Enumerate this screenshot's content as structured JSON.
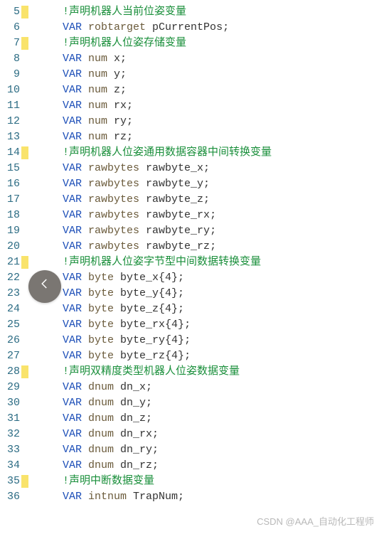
{
  "watermark": "CSDN @AAA_自动化工程师",
  "back_button_icon": "chevron-left",
  "lines": [
    {
      "n": 5,
      "m": true,
      "tokens": [
        {
          "c": "cmt",
          "t": "!声明机器人当前位姿变量"
        }
      ]
    },
    {
      "n": 6,
      "m": false,
      "tokens": [
        {
          "c": "kw",
          "t": "VAR"
        },
        {
          "c": "id",
          "t": " "
        },
        {
          "c": "ty",
          "t": "robtarget"
        },
        {
          "c": "id",
          "t": " pCurrentPos;"
        }
      ]
    },
    {
      "n": 7,
      "m": true,
      "tokens": [
        {
          "c": "cmt",
          "t": "!声明机器人位姿存储变量"
        }
      ]
    },
    {
      "n": 8,
      "m": false,
      "tokens": [
        {
          "c": "kw",
          "t": "VAR"
        },
        {
          "c": "id",
          "t": " "
        },
        {
          "c": "ty",
          "t": "num"
        },
        {
          "c": "id",
          "t": " x;"
        }
      ]
    },
    {
      "n": 9,
      "m": false,
      "tokens": [
        {
          "c": "kw",
          "t": "VAR"
        },
        {
          "c": "id",
          "t": " "
        },
        {
          "c": "ty",
          "t": "num"
        },
        {
          "c": "id",
          "t": " y;"
        }
      ]
    },
    {
      "n": 10,
      "m": false,
      "tokens": [
        {
          "c": "kw",
          "t": "VAR"
        },
        {
          "c": "id",
          "t": " "
        },
        {
          "c": "ty",
          "t": "num"
        },
        {
          "c": "id",
          "t": " z;"
        }
      ]
    },
    {
      "n": 11,
      "m": false,
      "tokens": [
        {
          "c": "kw",
          "t": "VAR"
        },
        {
          "c": "id",
          "t": " "
        },
        {
          "c": "ty",
          "t": "num"
        },
        {
          "c": "id",
          "t": " rx;"
        }
      ]
    },
    {
      "n": 12,
      "m": false,
      "tokens": [
        {
          "c": "kw",
          "t": "VAR"
        },
        {
          "c": "id",
          "t": " "
        },
        {
          "c": "ty",
          "t": "num"
        },
        {
          "c": "id",
          "t": " ry;"
        }
      ]
    },
    {
      "n": 13,
      "m": false,
      "tokens": [
        {
          "c": "kw",
          "t": "VAR"
        },
        {
          "c": "id",
          "t": " "
        },
        {
          "c": "ty",
          "t": "num"
        },
        {
          "c": "id",
          "t": " rz;"
        }
      ]
    },
    {
      "n": 14,
      "m": true,
      "tokens": [
        {
          "c": "cmt",
          "t": "!声明机器人位姿通用数据容器中间转换变量"
        }
      ]
    },
    {
      "n": 15,
      "m": false,
      "tokens": [
        {
          "c": "kw",
          "t": "VAR"
        },
        {
          "c": "id",
          "t": " "
        },
        {
          "c": "ty",
          "t": "rawbytes"
        },
        {
          "c": "id",
          "t": " rawbyte_x;"
        }
      ]
    },
    {
      "n": 16,
      "m": false,
      "tokens": [
        {
          "c": "kw",
          "t": "VAR"
        },
        {
          "c": "id",
          "t": " "
        },
        {
          "c": "ty",
          "t": "rawbytes"
        },
        {
          "c": "id",
          "t": " rawbyte_y;"
        }
      ]
    },
    {
      "n": 17,
      "m": false,
      "tokens": [
        {
          "c": "kw",
          "t": "VAR"
        },
        {
          "c": "id",
          "t": " "
        },
        {
          "c": "ty",
          "t": "rawbytes"
        },
        {
          "c": "id",
          "t": " rawbyte_z;"
        }
      ]
    },
    {
      "n": 18,
      "m": false,
      "tokens": [
        {
          "c": "kw",
          "t": "VAR"
        },
        {
          "c": "id",
          "t": " "
        },
        {
          "c": "ty",
          "t": "rawbytes"
        },
        {
          "c": "id",
          "t": " rawbyte_rx;"
        }
      ]
    },
    {
      "n": 19,
      "m": false,
      "tokens": [
        {
          "c": "kw",
          "t": "VAR"
        },
        {
          "c": "id",
          "t": " "
        },
        {
          "c": "ty",
          "t": "rawbytes"
        },
        {
          "c": "id",
          "t": " rawbyte_ry;"
        }
      ]
    },
    {
      "n": 20,
      "m": false,
      "tokens": [
        {
          "c": "kw",
          "t": "VAR"
        },
        {
          "c": "id",
          "t": " "
        },
        {
          "c": "ty",
          "t": "rawbytes"
        },
        {
          "c": "id",
          "t": " rawbyte_rz;"
        }
      ]
    },
    {
      "n": 21,
      "m": true,
      "tokens": [
        {
          "c": "cmt",
          "t": "!声明机器人位姿字节型中间数据转换变量"
        }
      ]
    },
    {
      "n": 22,
      "m": false,
      "tokens": [
        {
          "c": "kw",
          "t": "VAR"
        },
        {
          "c": "id",
          "t": " "
        },
        {
          "c": "ty",
          "t": "byte"
        },
        {
          "c": "id",
          "t": " byte_x{4};"
        }
      ]
    },
    {
      "n": 23,
      "m": false,
      "tokens": [
        {
          "c": "kw",
          "t": "VAR"
        },
        {
          "c": "id",
          "t": " "
        },
        {
          "c": "ty",
          "t": "byte"
        },
        {
          "c": "id",
          "t": " byte_y{4};"
        }
      ]
    },
    {
      "n": 24,
      "m": false,
      "tokens": [
        {
          "c": "kw",
          "t": "VAR"
        },
        {
          "c": "id",
          "t": " "
        },
        {
          "c": "ty",
          "t": "byte"
        },
        {
          "c": "id",
          "t": " byte_z{4};"
        }
      ]
    },
    {
      "n": 25,
      "m": false,
      "tokens": [
        {
          "c": "kw",
          "t": "VAR"
        },
        {
          "c": "id",
          "t": " "
        },
        {
          "c": "ty",
          "t": "byte"
        },
        {
          "c": "id",
          "t": " byte_rx{4};"
        }
      ]
    },
    {
      "n": 26,
      "m": false,
      "tokens": [
        {
          "c": "kw",
          "t": "VAR"
        },
        {
          "c": "id",
          "t": " "
        },
        {
          "c": "ty",
          "t": "byte"
        },
        {
          "c": "id",
          "t": " byte_ry{4};"
        }
      ]
    },
    {
      "n": 27,
      "m": false,
      "tokens": [
        {
          "c": "kw",
          "t": "VAR"
        },
        {
          "c": "id",
          "t": " "
        },
        {
          "c": "ty",
          "t": "byte"
        },
        {
          "c": "id",
          "t": " byte_rz{4};"
        }
      ]
    },
    {
      "n": 28,
      "m": true,
      "tokens": [
        {
          "c": "cmt",
          "t": "!声明双精度类型机器人位姿数据变量"
        }
      ]
    },
    {
      "n": 29,
      "m": false,
      "tokens": [
        {
          "c": "kw",
          "t": "VAR"
        },
        {
          "c": "id",
          "t": " "
        },
        {
          "c": "ty",
          "t": "dnum"
        },
        {
          "c": "id",
          "t": " dn_x;"
        }
      ]
    },
    {
      "n": 30,
      "m": false,
      "tokens": [
        {
          "c": "kw",
          "t": "VAR"
        },
        {
          "c": "id",
          "t": " "
        },
        {
          "c": "ty",
          "t": "dnum"
        },
        {
          "c": "id",
          "t": " dn_y;"
        }
      ]
    },
    {
      "n": 31,
      "m": false,
      "tokens": [
        {
          "c": "kw",
          "t": "VAR"
        },
        {
          "c": "id",
          "t": " "
        },
        {
          "c": "ty",
          "t": "dnum"
        },
        {
          "c": "id",
          "t": " dn_z;"
        }
      ]
    },
    {
      "n": 32,
      "m": false,
      "tokens": [
        {
          "c": "kw",
          "t": "VAR"
        },
        {
          "c": "id",
          "t": " "
        },
        {
          "c": "ty",
          "t": "dnum"
        },
        {
          "c": "id",
          "t": " dn_rx;"
        }
      ]
    },
    {
      "n": 33,
      "m": false,
      "tokens": [
        {
          "c": "kw",
          "t": "VAR"
        },
        {
          "c": "id",
          "t": " "
        },
        {
          "c": "ty",
          "t": "dnum"
        },
        {
          "c": "id",
          "t": " dn_ry;"
        }
      ]
    },
    {
      "n": 34,
      "m": false,
      "tokens": [
        {
          "c": "kw",
          "t": "VAR"
        },
        {
          "c": "id",
          "t": " "
        },
        {
          "c": "ty",
          "t": "dnum"
        },
        {
          "c": "id",
          "t": " dn_rz;"
        }
      ]
    },
    {
      "n": 35,
      "m": true,
      "tokens": [
        {
          "c": "cmt",
          "t": "!声明中断数据变量"
        }
      ]
    },
    {
      "n": 36,
      "m": false,
      "tokens": [
        {
          "c": "kw",
          "t": "VAR"
        },
        {
          "c": "id",
          "t": " "
        },
        {
          "c": "ty",
          "t": "intnum"
        },
        {
          "c": "id",
          "t": " TrapNum;"
        }
      ]
    }
  ]
}
